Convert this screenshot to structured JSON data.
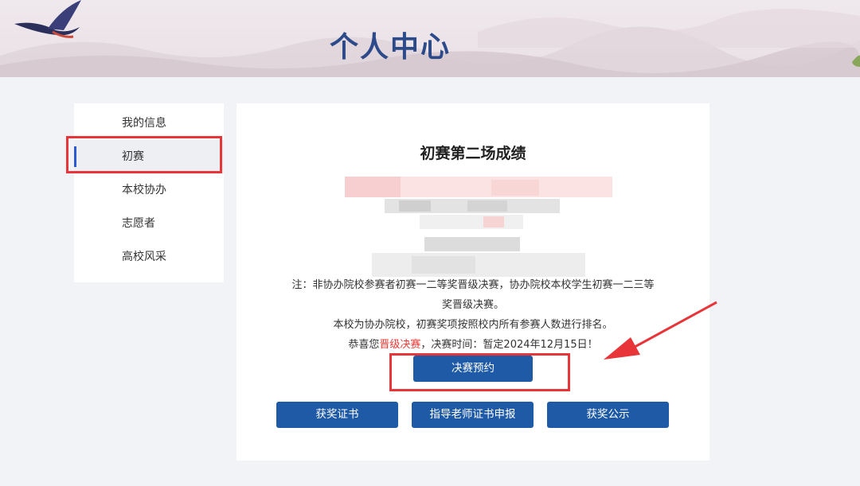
{
  "header": {
    "title": "个人中心"
  },
  "sidebar": {
    "items": [
      {
        "label": "我的信息"
      },
      {
        "label": "初赛"
      },
      {
        "label": "本校协办"
      },
      {
        "label": "志愿者"
      },
      {
        "label": "高校风采"
      }
    ],
    "active_index": 1
  },
  "main": {
    "title": "初赛第二场成绩",
    "note_line1": "注：非协办院校参赛者初赛一二等奖晋级决赛，协办院校本校学生初赛一二三等",
    "note_line2": "奖晋级决赛。",
    "note_line3": "本校为协办院校，初赛奖项按照校内所有参赛人数进行排名。",
    "congrats_prefix": "恭喜您",
    "congrats_highlight": "晋级决赛",
    "congrats_suffix": "，决赛时间：暂定2024年12月15日！",
    "reserve_button": "决赛预约",
    "buttons": {
      "certificate": "获奖证书",
      "teacher_certificate": "指导老师证书申报",
      "announcement": "获奖公示"
    }
  },
  "colors": {
    "primary_button": "#1f5aa6",
    "title_blue": "#2c4a8a",
    "highlight_red": "#e8353a",
    "active_bar": "#2f5bd0"
  }
}
